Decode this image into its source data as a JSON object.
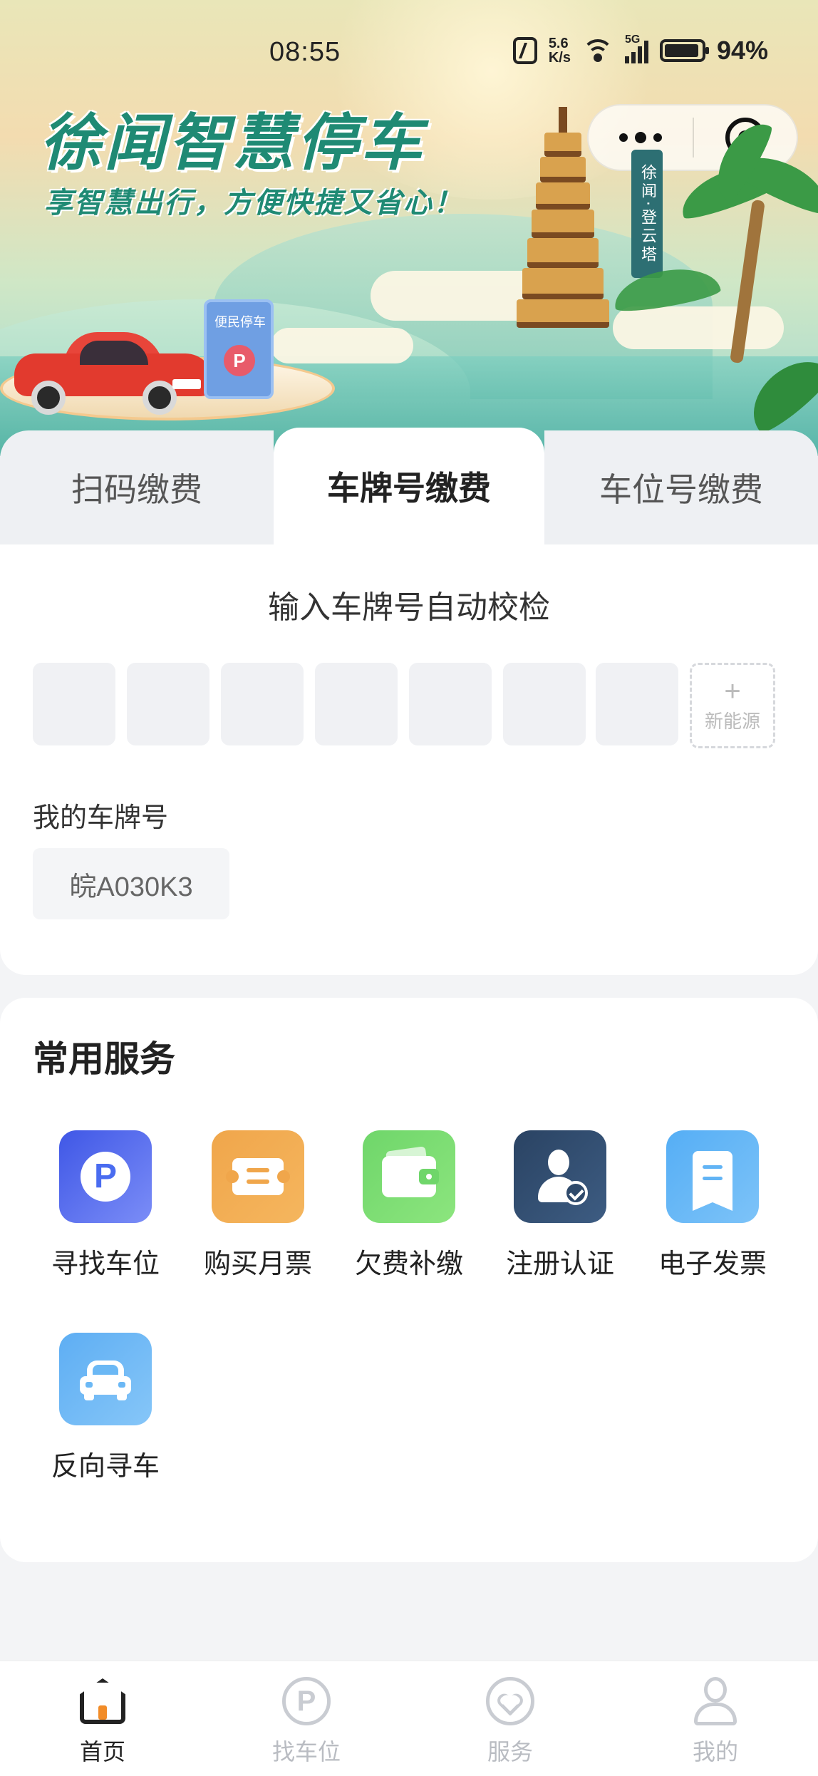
{
  "status_bar": {
    "time": "08:55",
    "net_speed_value": "5.6",
    "net_speed_unit": "K/s",
    "network_type": "5G",
    "battery": "94%",
    "icons": [
      "nfc-icon",
      "wifi-icon",
      "signal-icon",
      "battery-icon"
    ]
  },
  "banner": {
    "title": "徐闻智慧停车",
    "subtitle": "享智慧出行，方便快捷又省心！",
    "sign_text": "便民停车",
    "parking_glyph": "P",
    "pagoda_label": "徐闻·登云塔"
  },
  "capsule": {
    "menu_icon": "more-dots-icon",
    "close_icon": "target-close-icon"
  },
  "tabs": [
    {
      "label": "扫码缴费",
      "active": false
    },
    {
      "label": "车牌号缴费",
      "active": true
    },
    {
      "label": "车位号缴费",
      "active": false
    }
  ],
  "plate_input": {
    "title": "输入车牌号自动校检",
    "slots": [
      "",
      "",
      "",
      "",
      "",
      "",
      ""
    ],
    "new_energy_plus": "+",
    "new_energy_label": "新能源",
    "my_plates_label": "我的车牌号",
    "my_plates": [
      "皖A030K3"
    ]
  },
  "services": {
    "title": "常用服务",
    "items": [
      {
        "label": "寻找车位",
        "icon": "parking-icon",
        "color": "#4f6df2"
      },
      {
        "label": "购买月票",
        "icon": "ticket-icon",
        "color": "#f0a64b"
      },
      {
        "label": "欠费补缴",
        "icon": "wallet-icon",
        "color": "#6fd66a"
      },
      {
        "label": "注册认证",
        "icon": "verified-user-icon",
        "color": "#2f4a6b"
      },
      {
        "label": "电子发票",
        "icon": "invoice-icon",
        "color": "#62b4f5"
      },
      {
        "label": "反向寻车",
        "icon": "car-icon",
        "color": "#6bb8f5"
      }
    ]
  },
  "tabbar": {
    "items": [
      {
        "label": "首页",
        "icon": "home-icon",
        "active": true
      },
      {
        "label": "找车位",
        "icon": "parking-circle-icon",
        "active": false,
        "glyph": "P"
      },
      {
        "label": "服务",
        "icon": "heart-service-icon",
        "active": false
      },
      {
        "label": "我的",
        "icon": "user-icon",
        "active": false
      }
    ]
  }
}
